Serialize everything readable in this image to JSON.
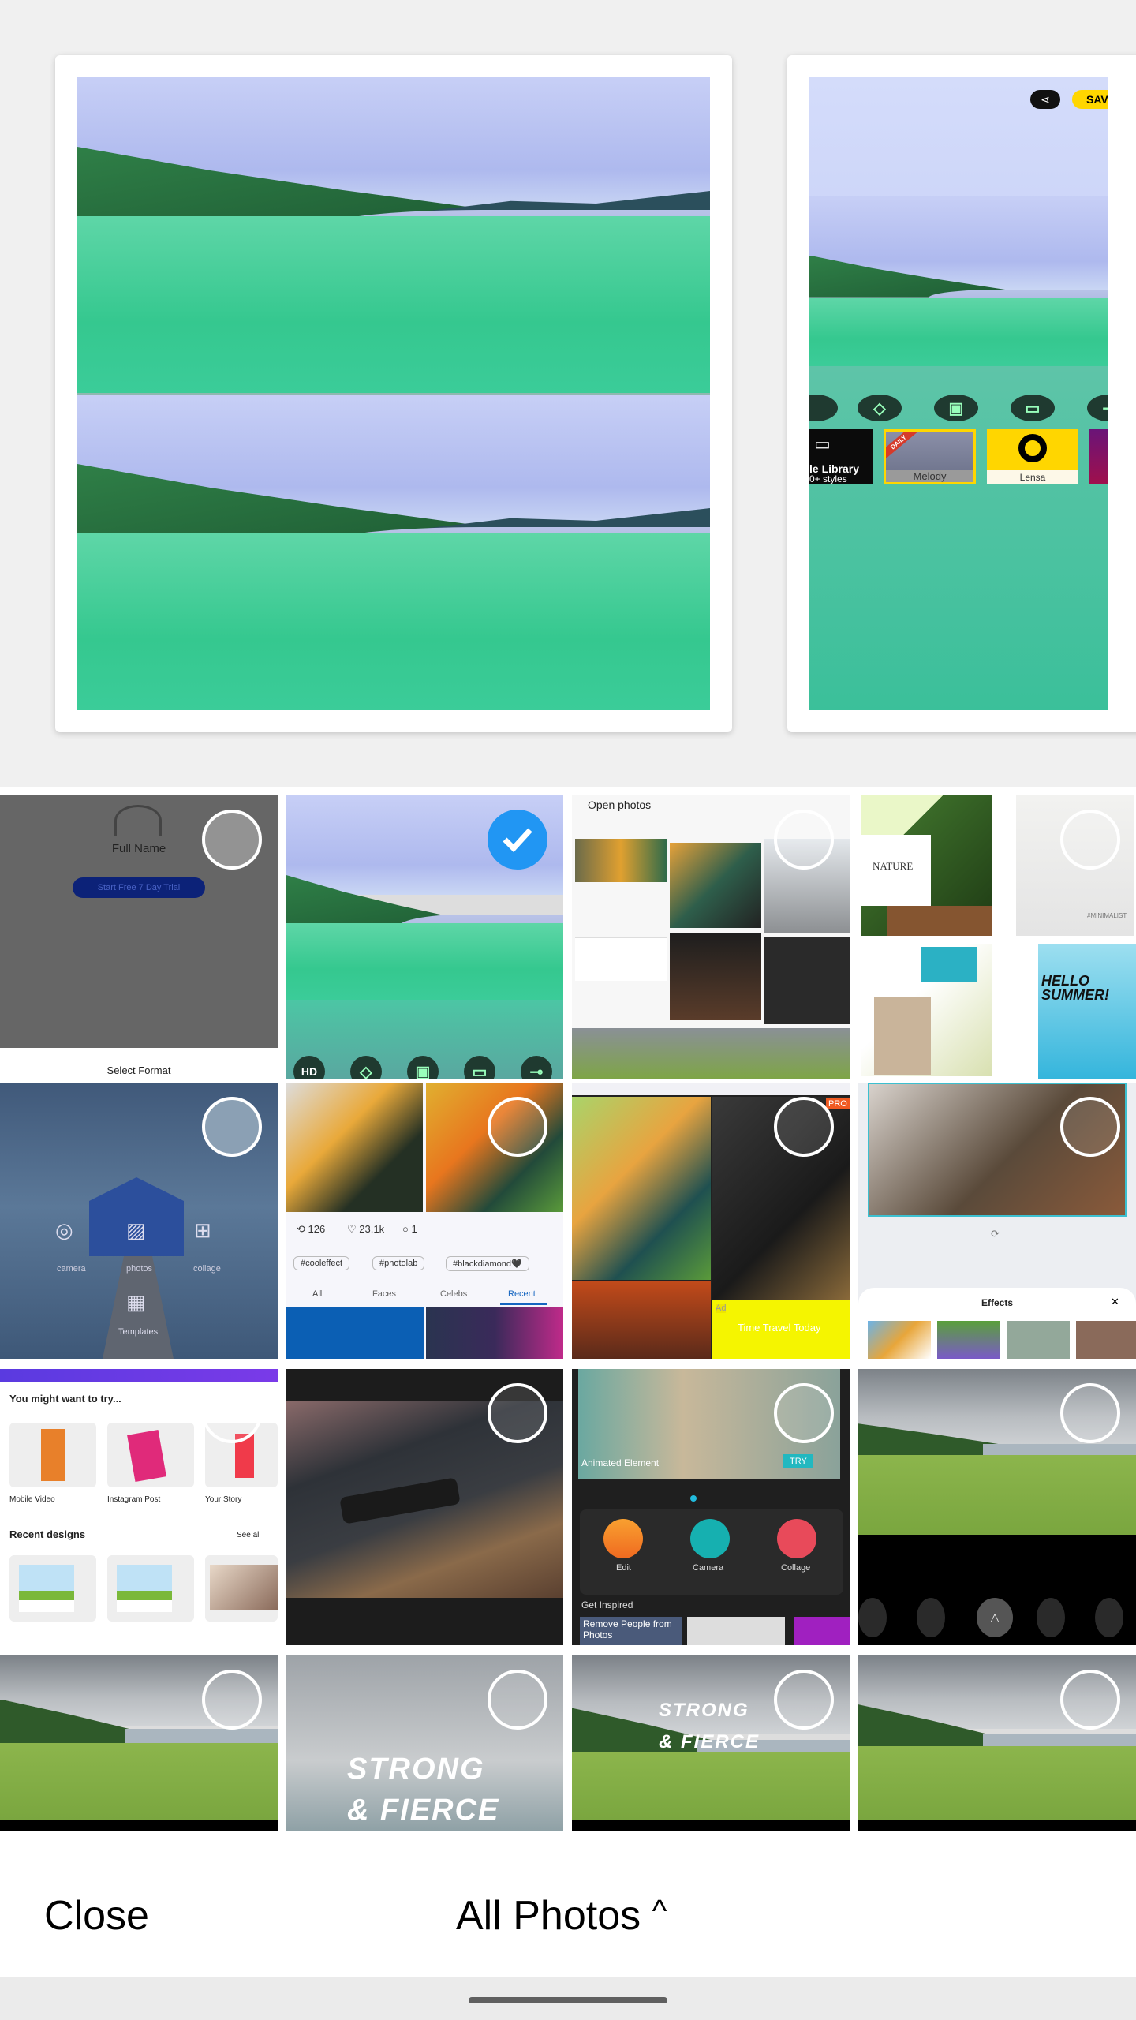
{
  "preview": {
    "share_icon": "share-icon",
    "save_label": "SAV",
    "styles": [
      {
        "title": "le Library",
        "subtitle": "0+ styles"
      },
      {
        "title": "Melody",
        "badge": "DAILY"
      },
      {
        "title": "Lensa"
      }
    ],
    "tool_icons": [
      "hd-icon",
      "layers-icon",
      "frame-icon",
      "gallery-icon",
      "adjust-icon"
    ]
  },
  "tiles": [
    {
      "kind": "signup",
      "full_name": "Full Name",
      "trial_button": "Start Free 7 Day Trial",
      "footer": "Select Format",
      "selected": false
    },
    {
      "kind": "art-edit",
      "hd_label": "HD",
      "selected": true
    },
    {
      "kind": "collage-screenshot",
      "title": "Open photos",
      "selected": false
    },
    {
      "kind": "templates",
      "nature": "NATURE",
      "minimalist": "#MINIMALIST",
      "hello_summer": "HELLO SUMMER!",
      "selected": false
    },
    {
      "kind": "boathouse",
      "items": [
        "camera",
        "photos",
        "collage",
        "Templates"
      ],
      "selected": false
    },
    {
      "kind": "photolab-feed",
      "reposts": "126",
      "likes": "23.1k",
      "comments": "1",
      "tags": [
        "#cooleffect",
        "#photolab",
        "#blackdiamond🖤"
      ],
      "tabs": [
        "All",
        "Faces",
        "Celebs",
        "Recent"
      ],
      "active_tab": "Recent",
      "selected": false
    },
    {
      "kind": "photolab-styles",
      "pro_badge": "PRO",
      "ad_label": "Ad",
      "ad_text": "Time Travel Today",
      "selected": false
    },
    {
      "kind": "effects-editor",
      "panel_title": "Effects",
      "selected": false
    },
    {
      "kind": "canva-home",
      "try_heading": "You might want to try...",
      "formats": [
        "Mobile Video",
        "Instagram Post",
        "Your Story"
      ],
      "recent_heading": "Recent designs",
      "see_all": "See all",
      "selected": false
    },
    {
      "kind": "keyboard-photo",
      "selected": false
    },
    {
      "kind": "picsart-home",
      "banner": "Animated Element",
      "try": "TRY",
      "actions": [
        "Edit",
        "Camera",
        "Collage"
      ],
      "inspired": "Get Inspired",
      "card": "Remove People from Photos",
      "selected": false
    },
    {
      "kind": "lake-hdr",
      "selected": false
    },
    {
      "kind": "lake-photo",
      "selected": false
    },
    {
      "kind": "strong-sky",
      "caption": "STRONG & FIERCE",
      "selected": false
    },
    {
      "kind": "strong-lake",
      "caption": "STRONG & FIERCE",
      "selected": false
    },
    {
      "kind": "lake-photo",
      "selected": false
    }
  ],
  "bottom_bar": {
    "close_label": "Close",
    "album_label": "All Photos",
    "album_chevron": "chevron-up-icon"
  },
  "colors": {
    "selected": "#2196f3",
    "save_button": "#ffd600",
    "accent_art": "#3bcc99"
  }
}
